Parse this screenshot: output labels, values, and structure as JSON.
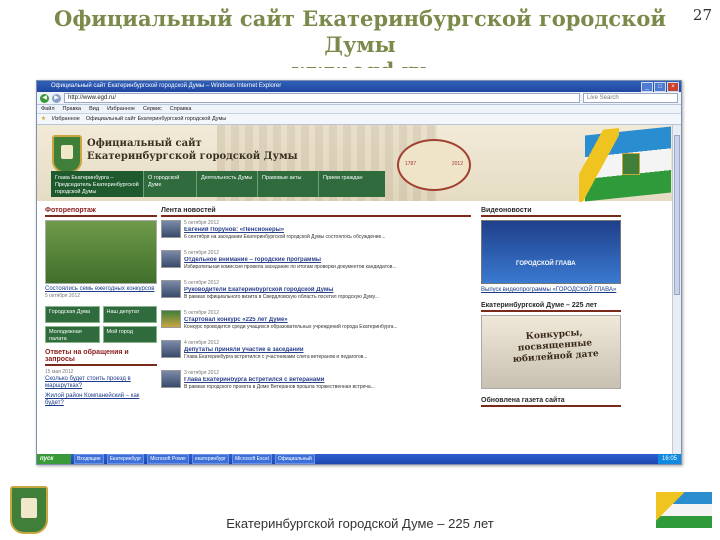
{
  "slide": {
    "title_line1": "Официальный сайт Екатеринбургской городской",
    "title_line2": "Думы",
    "title_line3": "www.egd.ru",
    "number": "27",
    "footer": "Екатеринбургской городской Думе – 225 лет"
  },
  "browser": {
    "window_title": "Официальный сайт Екатеринбургской городской Думы – Windows Internet Explorer",
    "address": "http://www.egd.ru/",
    "search_placeholder": "Live Search",
    "menu": [
      "Файл",
      "Правка",
      "Вид",
      "Избранное",
      "Сервис",
      "Справка"
    ],
    "favorites": [
      "Избранное",
      "Официальный сайт Екатеринбургской городской Думы"
    ],
    "taskbar": {
      "start": "пуск",
      "tasks": [
        "Входящие",
        "Екатеринбург",
        "Microsoft Power",
        "екатеринбург",
        "Microsoft Excel",
        "Официальный"
      ],
      "clock": "16:05"
    }
  },
  "site": {
    "name_line1": "Официальный сайт",
    "name_line2": "Екатеринбургской городской Думы",
    "year_left": "1787",
    "year_right": "2012",
    "nav": [
      "Глава Екатеринбурга – Председатель Екатеринбургской городской Думы",
      "О городской Думе",
      "Деятельность Думы",
      "Правовые акты",
      "Прием граждан"
    ],
    "left": {
      "section_photo": "Фоторепортаж",
      "photo_caption": "Состоялись семь ежегодных конкурсов",
      "photo_date": "5 октября 2012",
      "banners": [
        "Городская Дума",
        "Наш депутат",
        "Молодежная палата",
        "Мой город"
      ],
      "section_appeals": "Ответы на обращения и запросы",
      "appeal_date": "15 мая 2012",
      "appeal_1": "Сколько будет стоить проезд в маршрутках?",
      "appeal_2": "Жилой район Компанейский – как будет?"
    },
    "center": {
      "section": "Лента новостей",
      "news": [
        {
          "date": "5 октября 2012",
          "head": "Евгений Порунов: «Пенсионеры»",
          "text": "6 сентября на заседании Екатеринбургской городской Думы состоялось обсуждение..."
        },
        {
          "date": "5 октября 2012",
          "head": "Отдельное внимание – городские программы",
          "text": "Избирательная комиссия провела заседание по итогам проверки документов кандидатов..."
        },
        {
          "date": "5 октября 2012",
          "head": "Руководители Екатеринбургской городской Думы",
          "text": "В рамках официального визита в Свердловскую область посетил городскую Думу..."
        },
        {
          "date": "5 октября 2012",
          "head": "Стартовал конкурс «225 лет Думе»",
          "text": "Конкурс проводится среди учащихся образовательных учреждений города Екатеринбурга..."
        },
        {
          "date": "4 октября 2012",
          "head": "Депутаты приняли участие в заседании",
          "text": "Глава Екатеринбурга встретился с участниками слета ветеранов и педагогов..."
        },
        {
          "date": "3 октября 2012",
          "head": "Глава Екатеринбурга встретился с ветеранами",
          "text": "В рамках городского проекта в Доме Ветеранов прошла торжественная встреча..."
        }
      ]
    },
    "right": {
      "section_video": "Видеоновости",
      "video_label": "ГОРОДСКОЙ ГЛАВА",
      "video_caption": "Выпуск видеопрограммы «ГОРОДСКОЙ ГЛАВА»",
      "section_225": "Екатеринбургской Думе – 225 лет",
      "anniv_text": "Конкурсы, посвященные юбилейной дате",
      "section_paper": "Обновлена газета сайта"
    }
  }
}
